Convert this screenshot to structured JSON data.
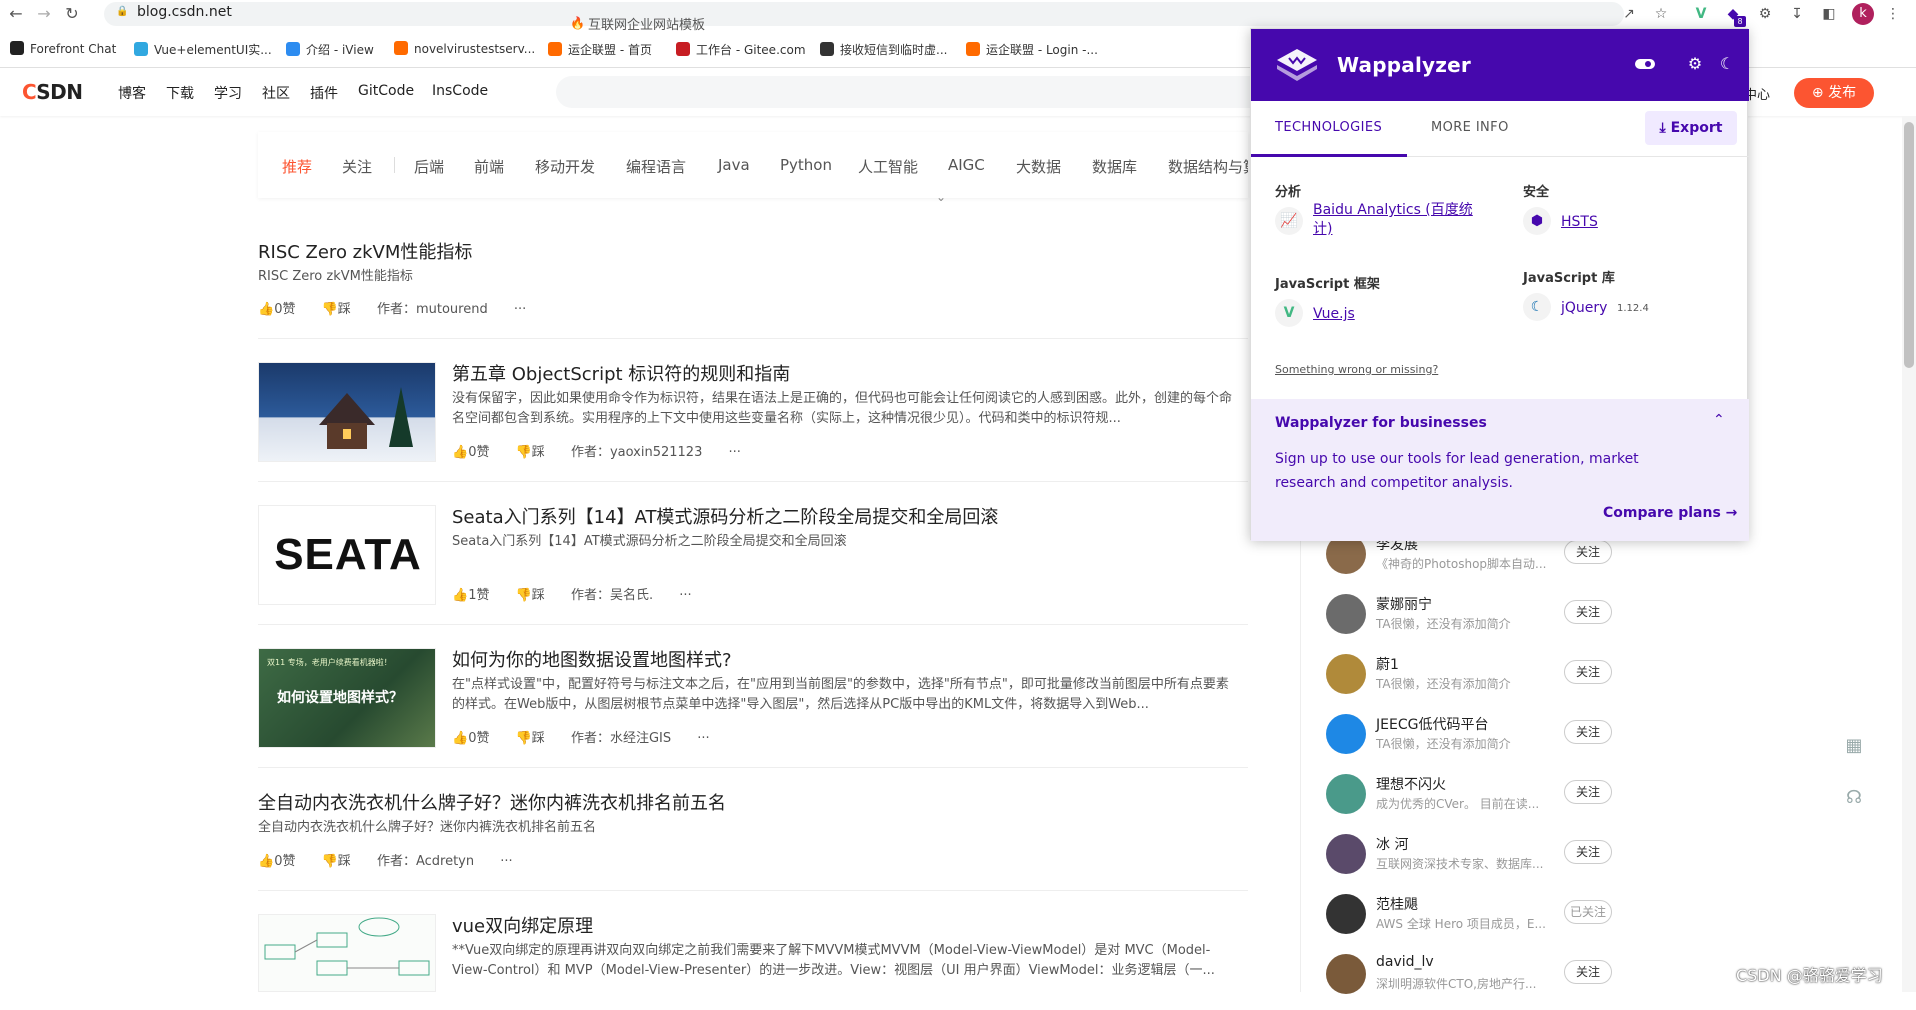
{
  "browser": {
    "url": "blog.csdn.net",
    "bookmarks": [
      {
        "label": "Forefront Chat",
        "color": "#222"
      },
      {
        "label": "Vue+elementUI实...",
        "color": "#31a8e0"
      },
      {
        "label": "介绍 - iView",
        "color": "#2d8cf0"
      },
      {
        "label": "novelvirustestserv...",
        "color": "#ff6a00"
      },
      {
        "label": "运企联盟 - 首页",
        "color": "#ff6a00"
      },
      {
        "label": "工作台 - Gitee.com",
        "color": "#c71d23"
      },
      {
        "label": "接收短信到临时虚...",
        "color": "#333"
      },
      {
        "label": "运企联盟 - Login -...",
        "color": "#ff6a00"
      }
    ],
    "ext_badge": "8",
    "profile_letter": "k"
  },
  "csdn": {
    "logo_c": "C",
    "logo_rest": "SDN",
    "nav": [
      "博客",
      "下载",
      "学习",
      "社区",
      "插件",
      "GitCode",
      "InsCode"
    ],
    "search_placeholder": "互联网企业网站模板",
    "center_link": "中心",
    "publish": "发布",
    "tabs": [
      "推荐",
      "关注",
      "后端",
      "前端",
      "移动开发",
      "编程语言",
      "Java",
      "Python",
      "人工智能",
      "AIGC",
      "大数据",
      "数据库",
      "数据结构与算"
    ],
    "active_tab": "推荐",
    "accent": "#fc5531"
  },
  "articles": [
    {
      "title": "RISC Zero zkVM性能指标",
      "desc": "RISC Zero zkVM性能指标",
      "likes": "0赞",
      "dislike": "踩",
      "author": "作者：mutourend",
      "more": "···"
    },
    {
      "title": "第五章 ObjectScript 标识符的规则和指南",
      "desc": "没有保留字，因此如果使用命令作为标识符，结果在语法上是正确的，但代码也可能会让任何阅读它的人感到困惑。此外，创建的每个命名空间都包含到系统。实用程序的上下文中使用这些变量名称（实际上，这种情况很少见）。代码和类中的标识符规...",
      "likes": "0赞",
      "dislike": "踩",
      "author": "作者：yaoxin521123",
      "more": "···"
    },
    {
      "title": "Seata入门系列【14】AT模式源码分析之二阶段全局提交和全局回滚",
      "desc": "Seata入门系列【14】AT模式源码分析之二阶段全局提交和全局回滚",
      "likes": "1赞",
      "dislike": "踩",
      "author": "作者：吴名氏.",
      "more": "···",
      "thumb_text": "SEATA"
    },
    {
      "title": "如何为你的地图数据设置地图样式?",
      "desc": "在\"点样式设置\"中，配置好符号与标注文本之后，在\"应用到当前图层\"的参数中，选择\"所有节点\"，即可批量修改当前图层中所有点要素的样式。在Web版中，从图层树根节点菜单中选择\"导入图层\"，然后选择从PC版中导出的KML文件，将数据导入到Web...",
      "likes": "0赞",
      "dislike": "踩",
      "author": "作者：水经注GIS",
      "more": "···",
      "thumb_text": "如何设置地图样式？",
      "thumb_small": "双11 专场，老用户续费看机器啦！"
    },
    {
      "title": "全自动内衣洗衣机什么牌子好？迷你内裤洗衣机排名前五名",
      "desc": "全自动内衣洗衣机什么牌子好？迷你内裤洗衣机排名前五名",
      "likes": "0赞",
      "dislike": "踩",
      "author": "作者：Acdretyn",
      "more": "···"
    },
    {
      "title": "vue双向绑定原理",
      "desc": "**Vue双向绑定的原理再讲双向双向绑定之前我们需要来了解下MVVM模式MVVM（Model-View-ViewModel）是对 MVC（Model-View-Control）和 MVP（Model-View-Presenter）的进一步改进。View：视图层（UI 用户界面）ViewModel：业务逻辑层（一...",
      "likes": "",
      "dislike": "",
      "author": "",
      "more": ""
    }
  ],
  "users": [
    {
      "name": "李发展",
      "desc": "《神奇的Photoshop脚本自动...",
      "follow": "关注",
      "color": "#8a6a4a"
    },
    {
      "name": "蒙娜丽宁",
      "desc": "TA很懒，还没有添加简介",
      "follow": "关注",
      "color": "#6b6b6b"
    },
    {
      "name": "蔚1",
      "desc": "TA很懒，还没有添加简介",
      "follow": "关注",
      "color": "#b08a3a"
    },
    {
      "name": "JEECG低代码平台",
      "desc": "TA很懒，还没有添加简介",
      "follow": "关注",
      "color": "#1e88e5"
    },
    {
      "name": "理想不闪火",
      "desc": "成为优秀的CVer。 目前在读...",
      "follow": "关注",
      "color": "#4a9a8a"
    },
    {
      "name": "冰 河",
      "desc": "互联网资深技术专家、数据库...",
      "follow": "关注",
      "color": "#5a4a6a"
    },
    {
      "name": "范桂飓",
      "desc": "AWS 全球 Hero 项目成员，E...",
      "follow": "已关注",
      "color": "#333"
    },
    {
      "name": "david_lv",
      "desc": "深圳明源软件CTO,房地产行...",
      "follow": "关注",
      "color": "#7a5a3a"
    }
  ],
  "wappalyzer": {
    "title": "Wappalyzer",
    "tab_technologies": "TECHNOLOGIES",
    "tab_more_info": "MORE INFO",
    "export": "Export",
    "categories": [
      {
        "name": "分析",
        "tech": "Baidu Analytics (百度统计)",
        "icon": "chart"
      },
      {
        "name": "安全",
        "tech": "HSTS",
        "icon": "hsts"
      },
      {
        "name": "JavaScript 框架",
        "tech": "Vue.js",
        "icon": "vue"
      },
      {
        "name": "JavaScript 库",
        "tech": "jQuery",
        "version": "1.12.4",
        "icon": "jquery"
      }
    ],
    "wrong": "Something wrong or missing?",
    "biz_title": "Wappalyzer for businesses",
    "biz_text": "Sign up to use our tools for lead generation, market research and competitor analysis.",
    "compare": "Compare plans",
    "brand": "#4608ad"
  },
  "watermark": "CSDN @骆骆爱学习"
}
